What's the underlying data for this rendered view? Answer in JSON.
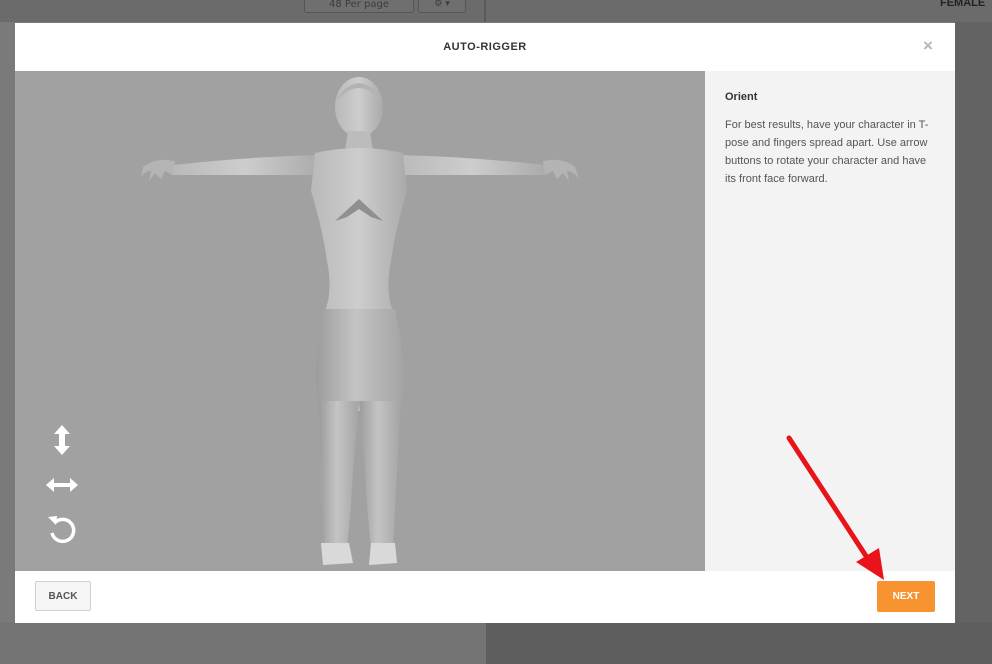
{
  "background": {
    "per_page_label": "48 Per page",
    "top_right_label": "FEMALE"
  },
  "modal": {
    "title": "AUTO-RIGGER",
    "close_symbol": "×"
  },
  "viewport": {
    "tools": [
      {
        "name": "move-vertical-icon",
        "icon": "up-down-arrow"
      },
      {
        "name": "move-horizontal-icon",
        "icon": "left-right-arrow"
      },
      {
        "name": "rotate-icon",
        "icon": "counterclockwise-rotate"
      }
    ]
  },
  "info": {
    "title": "Orient",
    "text": "For best results, have your character in T-pose and fingers spread apart. Use arrow buttons to rotate your character and have its front face forward."
  },
  "footer": {
    "back_label": "BACK",
    "next_label": "NEXT"
  },
  "colors": {
    "accent": "#f7942f",
    "annotation_arrow": "#e8141a",
    "viewport_bg": "#a1a1a1",
    "panel_bg": "#f3f3f3"
  }
}
